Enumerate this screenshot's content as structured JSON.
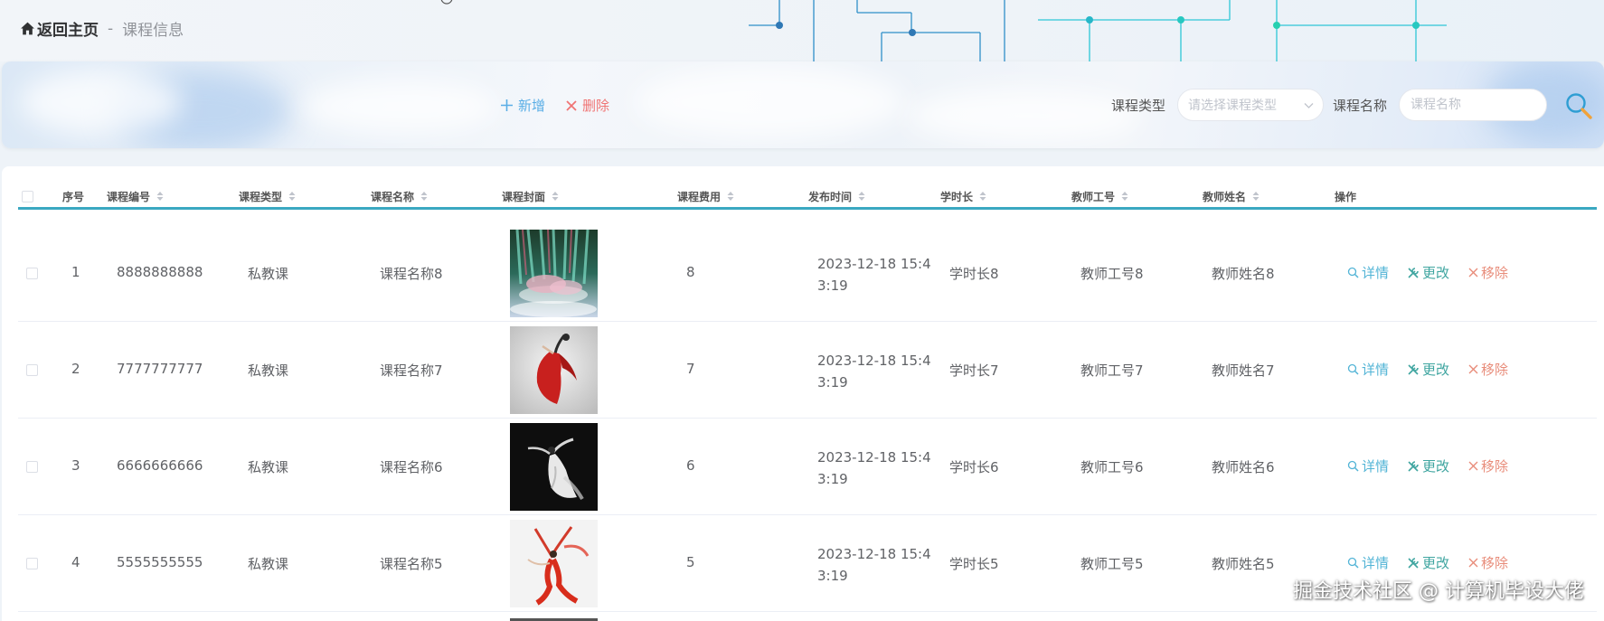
{
  "breadcrumb": {
    "home": "返回主页",
    "separator": "-",
    "current": "课程信息"
  },
  "toolbar": {
    "add_label": "新增",
    "delete_label": "删除",
    "filter_type_label": "课程类型",
    "filter_type_placeholder": "请选择课程类型",
    "filter_name_label": "课程名称",
    "filter_name_placeholder": "课程名称"
  },
  "colors": {
    "accent": "#3aa8c1",
    "add": "#5aaee6",
    "delete": "#f07474",
    "detail": "#52b4d6",
    "edit": "#3fa5a0",
    "remove": "#e88c7a"
  },
  "table": {
    "headers": {
      "index": "序号",
      "code": "课程编号",
      "type": "课程类型",
      "name": "课程名称",
      "cover": "课程封面",
      "fee": "课程费用",
      "time": "发布时间",
      "duration": "学时长",
      "teacher_no": "教师工号",
      "teacher_name": "教师姓名",
      "ops": "操作"
    },
    "rows": [
      {
        "index": "1",
        "code": "8888888888",
        "type": "私教课",
        "name": "课程名称8",
        "cover": "group-dance-stage-image",
        "fee": "8",
        "time_l1": "2023-12-18 15:4",
        "time_l2": "3:19",
        "duration": "学时长8",
        "teacher_no": "教师工号8",
        "teacher_name": "教师姓名8"
      },
      {
        "index": "2",
        "code": "7777777777",
        "type": "私教课",
        "name": "课程名称7",
        "cover": "red-dress-dancer-image",
        "fee": "7",
        "time_l1": "2023-12-18 15:4",
        "time_l2": "3:19",
        "duration": "学时长7",
        "teacher_no": "教师工号7",
        "teacher_name": "教师姓名7"
      },
      {
        "index": "3",
        "code": "6666666666",
        "type": "私教课",
        "name": "课程名称6",
        "cover": "white-dress-dancer-image",
        "fee": "6",
        "time_l1": "2023-12-18 15:4",
        "time_l2": "3:19",
        "duration": "学时长6",
        "teacher_no": "教师工号6",
        "teacher_name": "教师姓名6"
      },
      {
        "index": "4",
        "code": "5555555555",
        "type": "私教课",
        "name": "课程名称5",
        "cover": "red-ribbon-dancer-image",
        "fee": "5",
        "time_l1": "2023-12-18 15:4",
        "time_l2": "3:19",
        "duration": "学时长5",
        "teacher_no": "教师工号5",
        "teacher_name": "教师姓名5"
      }
    ],
    "ops": {
      "detail": "详情",
      "edit": "更改",
      "remove": "移除"
    }
  },
  "watermark": "掘金技术社区 @ 计算机毕设大佬"
}
